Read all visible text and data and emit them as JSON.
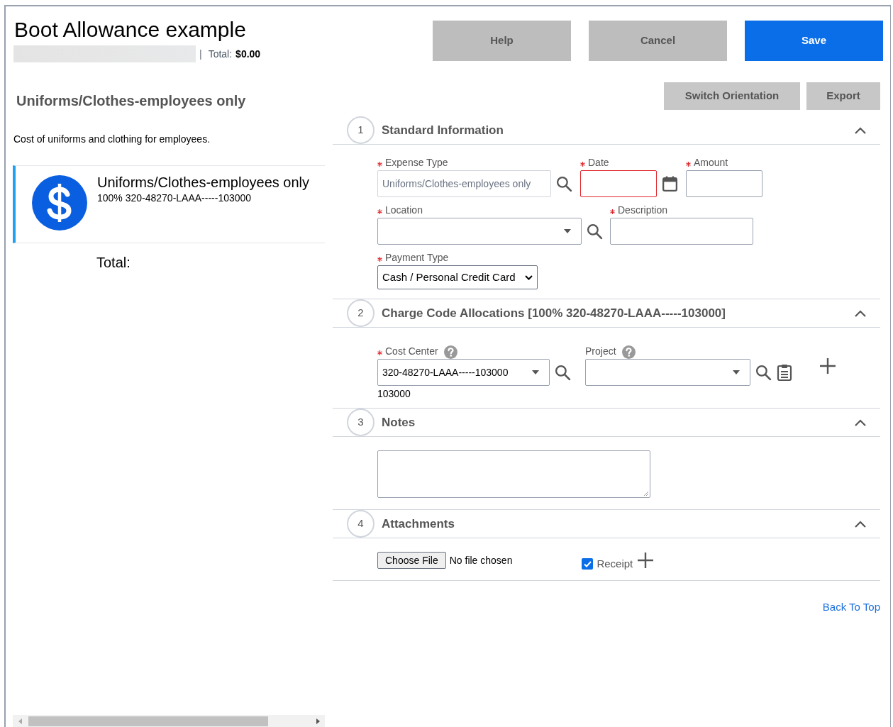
{
  "header": {
    "title": "Boot Allowance example",
    "separator": "|",
    "total_label": "Total:",
    "total_value": "$0.00"
  },
  "buttons": [
    {
      "label": "Help",
      "kind": "secondary"
    },
    {
      "label": "Cancel",
      "kind": "secondary"
    },
    {
      "label": "Save",
      "kind": "primary"
    }
  ],
  "expense": {
    "heading": "Uniforms/Clothes-employees only",
    "description": "Cost of uniforms and clothing for employees."
  },
  "view_buttons": [
    "Switch Orientation",
    "Export"
  ],
  "expense_list": [
    {
      "title": "Uniforms/Clothes-employees only",
      "allocation": "100% 320-48270-LAAA-----103000",
      "selected": true
    }
  ],
  "total_label": "Total:",
  "sections": [
    {
      "number": "1",
      "title": "Standard Information",
      "expanded": true,
      "kind": "standard",
      "rows": [
        [
          {
            "kind": "lookup",
            "label": "Expense Type",
            "required": true,
            "value": "Uniforms/Clothes-employees only",
            "disabled": true
          },
          {
            "kind": "date",
            "label": "Date",
            "required": true,
            "invalid": true
          },
          {
            "kind": "text",
            "label": "Amount",
            "required": true
          }
        ],
        [
          {
            "kind": "combo_lookup",
            "label": "Location",
            "required": true
          },
          {
            "kind": "text",
            "label": "Description",
            "required": true
          }
        ],
        [
          {
            "kind": "select",
            "label": "Payment Type",
            "required": true,
            "value": "Cash / Personal Credit Card"
          }
        ]
      ]
    },
    {
      "number": "2",
      "title": "Charge Code Allocations [100% 320-48270-LAAA-----103000]",
      "expanded": true,
      "kind": "allocations",
      "rows": [
        [
          {
            "kind": "combo_lookup",
            "label": "Cost Center",
            "required": true,
            "help": true,
            "value": "320-48270-LAAA-----103000",
            "note": "103000"
          },
          {
            "kind": "combo_lookup",
            "label": "Project",
            "required": false,
            "help": true,
            "clipboard": true
          },
          {
            "kind": "add"
          }
        ]
      ]
    },
    {
      "number": "3",
      "title": "Notes",
      "expanded": true,
      "kind": "notes",
      "rows": [
        [
          {
            "kind": "textarea"
          }
        ]
      ]
    },
    {
      "number": "4",
      "title": "Attachments",
      "expanded": true,
      "kind": "attachments",
      "file_button": "Choose File",
      "file_status": "No file chosen",
      "receipt": {
        "label": "Receipt",
        "checked": true
      }
    }
  ],
  "back_to_top": "Back To Top"
}
